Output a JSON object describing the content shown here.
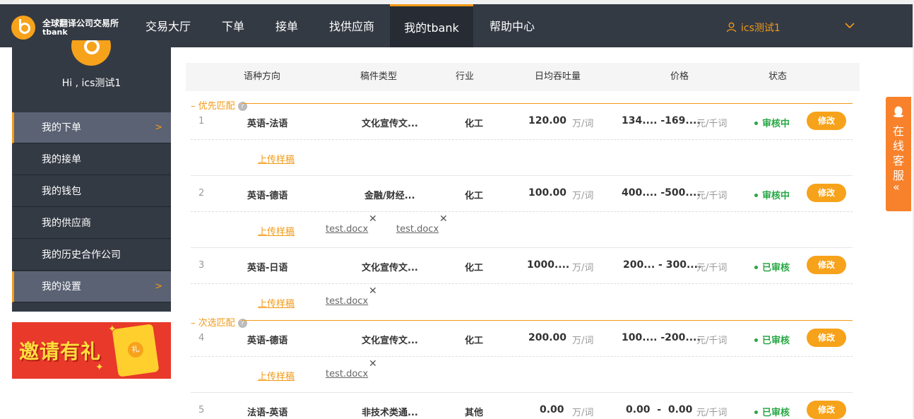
{
  "brand": {
    "name_cn": "全球翻译公司交易所",
    "name_en": "tbank"
  },
  "nav": {
    "items": [
      "交易大厅",
      "下单",
      "接单",
      "找供应商",
      "我的tbank",
      "帮助中心"
    ],
    "active": "我的tbank",
    "user": "ics测试1"
  },
  "sidebar": {
    "greeting": "Hi , ics测试1",
    "items": [
      {
        "label": "我的下单",
        "arrow": ">"
      },
      {
        "label": "我的接单"
      },
      {
        "label": "我的钱包"
      },
      {
        "label": "我的供应商"
      },
      {
        "label": "我的历史合作公司"
      },
      {
        "label": "我的设置",
        "arrow": ">"
      }
    ]
  },
  "banner": {
    "text": "邀请有礼",
    "seal": "礼"
  },
  "table": {
    "headers": [
      "语种方向",
      "稿件类型",
      "行业",
      "日均吞吐量",
      "价格",
      "状态"
    ],
    "groups": [
      "优先匹配",
      "次选匹配"
    ],
    "rows": [
      {
        "index": "1",
        "lang": "英语-法语",
        "type": "文化宣传文...",
        "industry": "化工",
        "throughput": "120.00",
        "throughput_unit": "万/词",
        "price": "134.... -169....",
        "price_unit": "元/千词",
        "status": "审核中",
        "action": "修改",
        "upload": "上传样稿",
        "files": []
      },
      {
        "index": "2",
        "lang": "英语-德语",
        "type": "金融/财经...",
        "industry": "化工",
        "throughput": "100.00",
        "throughput_unit": "万/词",
        "price": "400.... -500....",
        "price_unit": "元/千词",
        "status": "审核中",
        "action": "修改",
        "upload": "上传样稿",
        "files": [
          "test.docx",
          "test.docx"
        ]
      },
      {
        "index": "3",
        "lang": "英语-日语",
        "type": "文化宣传文...",
        "industry": "化工",
        "throughput": "1000....",
        "throughput_unit": "万/词",
        "price": "200... - 300....",
        "price_unit": "元/千词",
        "status": "已审核",
        "action": "修改",
        "upload": "上传样稿",
        "files": [
          "test.docx"
        ]
      },
      {
        "index": "4",
        "lang": "英语-德语",
        "type": "文化宣传文...",
        "industry": "化工",
        "throughput": "200.00",
        "throughput_unit": "万/词",
        "price": "100.... -200....",
        "price_unit": "元/千词",
        "status": "已审核",
        "action": "修改",
        "upload": "上传样稿",
        "files": [
          "test.docx"
        ]
      },
      {
        "index": "5",
        "lang": "法语-英语",
        "type": "非技术类通...",
        "industry": "其他",
        "throughput": "0.00",
        "throughput_unit": "万/词",
        "price": "0.00  -  0.00",
        "price_unit": "元/千词",
        "status": "已审核",
        "action": "修改"
      }
    ]
  },
  "customer_service": {
    "label": "在线客服",
    "arrow": "«"
  },
  "colors": {
    "accent": "#f39a16",
    "nav_bg": "#343a44",
    "status_green": "#27a744"
  }
}
